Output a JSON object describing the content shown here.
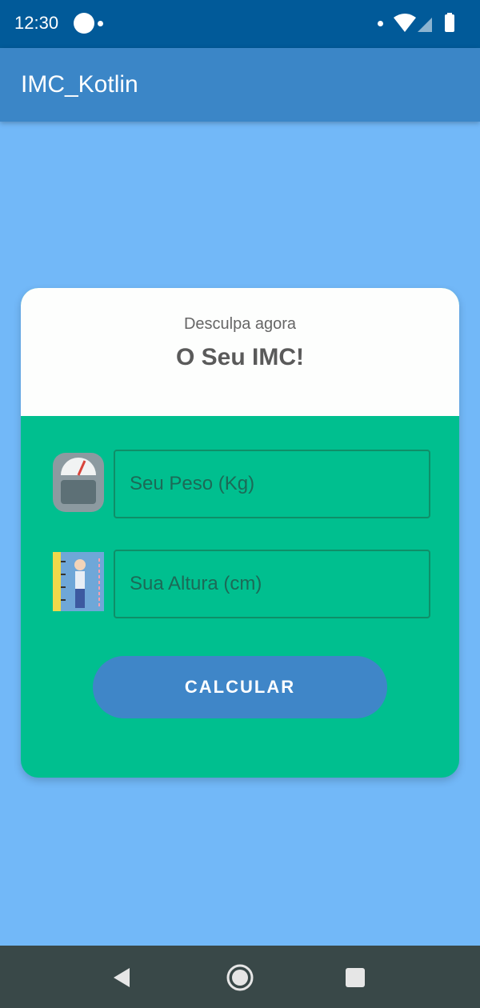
{
  "status_bar": {
    "time": "12:30"
  },
  "app_bar": {
    "title": "IMC_Kotlin"
  },
  "card": {
    "subtitle": "Desculpa agora",
    "title": "O Seu IMC!",
    "weight_field": {
      "placeholder": "Seu Peso (Kg)",
      "value": ""
    },
    "height_field": {
      "placeholder": "Sua Altura (cm)",
      "value": ""
    },
    "calculate_label": "CALCULAR"
  },
  "colors": {
    "background": "#72b8f8",
    "status_bar": "#015a99",
    "app_bar": "#3b86c7",
    "card_body": "#00bf8f",
    "button": "#3f86c8"
  },
  "icons": [
    "scale-icon",
    "height-measure-icon",
    "back-icon",
    "home-icon",
    "recents-icon",
    "wifi-icon",
    "signal-icon",
    "battery-icon"
  ]
}
